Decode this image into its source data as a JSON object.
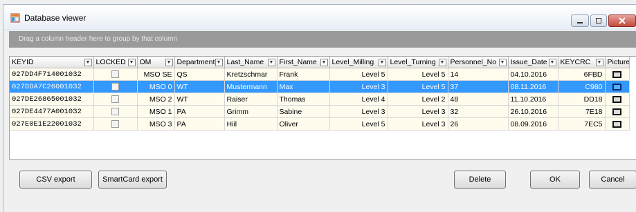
{
  "window": {
    "title": "Database viewer"
  },
  "group_panel": {
    "text": "Drag a column header here to group by that column"
  },
  "columns": [
    "KEYID",
    "LOCKED",
    "OM",
    "Department",
    "Last_Name",
    "First_Name",
    "Level_Milling",
    "Level_Turning",
    "Personnel_No",
    "Issue_Date",
    "KEYCRC",
    "Picture"
  ],
  "rows": [
    {
      "keyid": "027DD4F714001032",
      "om": "MSO SE",
      "dept": "QS",
      "last": "Kretzschmar",
      "first": "Frank",
      "milling": "Level 5",
      "turning": "Level 5",
      "pno": "14",
      "date": "04.10.2016",
      "crc": "6FBD",
      "selected": false
    },
    {
      "keyid": "027DDA7C26001032",
      "om": "MSO 0",
      "dept": "WT",
      "last": "Mustermann",
      "first": "Max",
      "milling": "Level 3",
      "turning": "Level 5",
      "pno": "37",
      "date": "08.11.2016",
      "crc": "C980",
      "selected": true
    },
    {
      "keyid": "027DE26865001032",
      "om": "MSO 2",
      "dept": "WT",
      "last": "Raiser",
      "first": "Thomas",
      "milling": "Level 4",
      "turning": "Level 2",
      "pno": "48",
      "date": "11.10.2016",
      "crc": "DD18",
      "selected": false
    },
    {
      "keyid": "027DE4477A001032",
      "om": "MSO 1",
      "dept": "PA",
      "last": "Grimm",
      "first": "Sabine",
      "milling": "Level 3",
      "turning": "Level 3",
      "pno": "32",
      "date": "26.10.2016",
      "crc": "7E18",
      "selected": false
    },
    {
      "keyid": "027E0E1E22001032",
      "om": "MSO 3",
      "dept": "PA",
      "last": "Hiil",
      "first": "Oliver",
      "milling": "Level 5",
      "turning": "Level 3",
      "pno": "26",
      "date": "08.09.2016",
      "crc": "7EC5",
      "selected": false
    }
  ],
  "buttons": {
    "csv": "CSV export",
    "smart": "SmartCard export",
    "delete": "Delete",
    "ok": "OK",
    "cancel": "Cancel"
  },
  "colors": {
    "selection": "#3399ff",
    "row_bg": "#fffcee",
    "group_panel": "#9a9a9a"
  }
}
